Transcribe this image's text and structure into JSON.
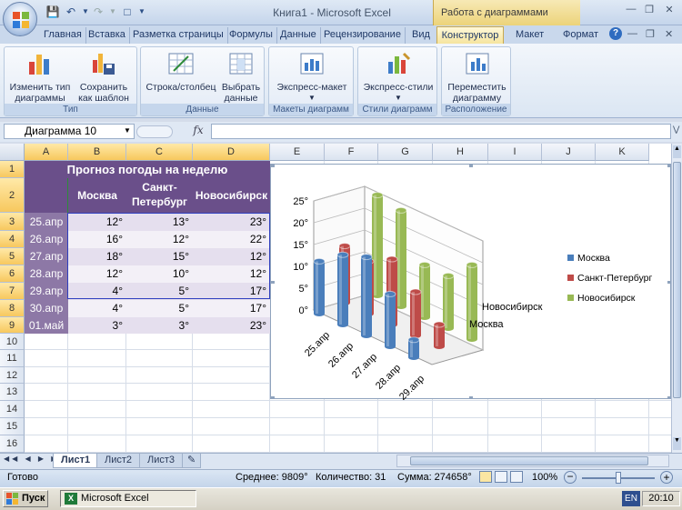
{
  "window": {
    "title": "Книга1 - Microsoft Excel",
    "context_group": "Работа с диаграммами"
  },
  "tabs": [
    "Главная",
    "Вставка",
    "Разметка страницы",
    "Формулы",
    "Данные",
    "Рецензирование",
    "Вид",
    "Конструктор",
    "Макет",
    "Формат"
  ],
  "ribbon": {
    "groups": {
      "type": "Тип",
      "data": "Данные",
      "layouts": "Макеты диаграмм",
      "styles": "Стили диаграмм",
      "location": "Расположение"
    },
    "buttons": {
      "change_type": [
        "Изменить тип",
        "диаграммы"
      ],
      "save_template": [
        "Сохранить",
        "как шаблон"
      ],
      "row_col": "Строка/столбец",
      "select_data": [
        "Выбрать",
        "данные"
      ],
      "quick_layout": "Экспресс-макет",
      "quick_styles": "Экспресс-стили",
      "move_chart": [
        "Переместить",
        "диаграмму"
      ]
    }
  },
  "formula_bar": {
    "name_box": "Диаграмма 10",
    "fx": "fx",
    "formula": ""
  },
  "columns": [
    "A",
    "B",
    "C",
    "D",
    "E",
    "F",
    "G",
    "H",
    "I",
    "J",
    "K"
  ],
  "rows": [
    "1",
    "2",
    "3",
    "4",
    "5",
    "6",
    "7",
    "8",
    "9",
    "10",
    "11",
    "12",
    "13",
    "14",
    "15",
    "16"
  ],
  "table": {
    "title": "Прогноз погоды на неделю",
    "headers": [
      "Москва",
      "Санкт-\nПетербург",
      "Новосибирск"
    ],
    "header_spb": [
      "Санкт-",
      "Петербург"
    ],
    "rows": [
      {
        "date": "25.апр",
        "msk": "12°",
        "spb": "13°",
        "nsk": "23°"
      },
      {
        "date": "26.апр",
        "msk": "16°",
        "spb": "12°",
        "nsk": "22°"
      },
      {
        "date": "27.апр",
        "msk": "18°",
        "spb": "15°",
        "nsk": "12°"
      },
      {
        "date": "28.апр",
        "msk": "12°",
        "spb": "10°",
        "nsk": "12°"
      },
      {
        "date": "29.апр",
        "msk": "4°",
        "spb": "5°",
        "nsk": "17°"
      },
      {
        "date": "30.апр",
        "msk": "4°",
        "spb": "5°",
        "nsk": "17°"
      },
      {
        "date": "01.май",
        "msk": "3°",
        "spb": "3°",
        "nsk": "23°"
      }
    ]
  },
  "chart_data": {
    "type": "bar",
    "categories": [
      "25.апр",
      "26.апр",
      "27.апр",
      "28.апр",
      "29.апр"
    ],
    "series": [
      {
        "name": "Москва",
        "values": [
          12,
          16,
          18,
          12,
          4
        ],
        "color": "#4a7ebb"
      },
      {
        "name": "Санкт-Петербург",
        "values": [
          13,
          12,
          15,
          10,
          5
        ],
        "color": "#be4b48"
      },
      {
        "name": "Новосибирск",
        "values": [
          23,
          22,
          12,
          12,
          17
        ],
        "color": "#98b954"
      }
    ],
    "y_ticks": [
      "0°",
      "5°",
      "10°",
      "15°",
      "20°",
      "25°"
    ],
    "depth_labels": [
      "Новосибирск",
      "Москва"
    ],
    "ylim": [
      0,
      25
    ],
    "legend_position": "right",
    "grid": true
  },
  "sheets": [
    "Лист1",
    "Лист2",
    "Лист3"
  ],
  "status": {
    "ready": "Готово",
    "average": "Среднее: 9809°",
    "count": "Количество: 31",
    "sum": "Сумма: 274658°",
    "zoom": "100%"
  },
  "taskbar": {
    "start": "Пуск",
    "app": "Microsoft Excel",
    "lang": "EN",
    "time": "20:10"
  }
}
